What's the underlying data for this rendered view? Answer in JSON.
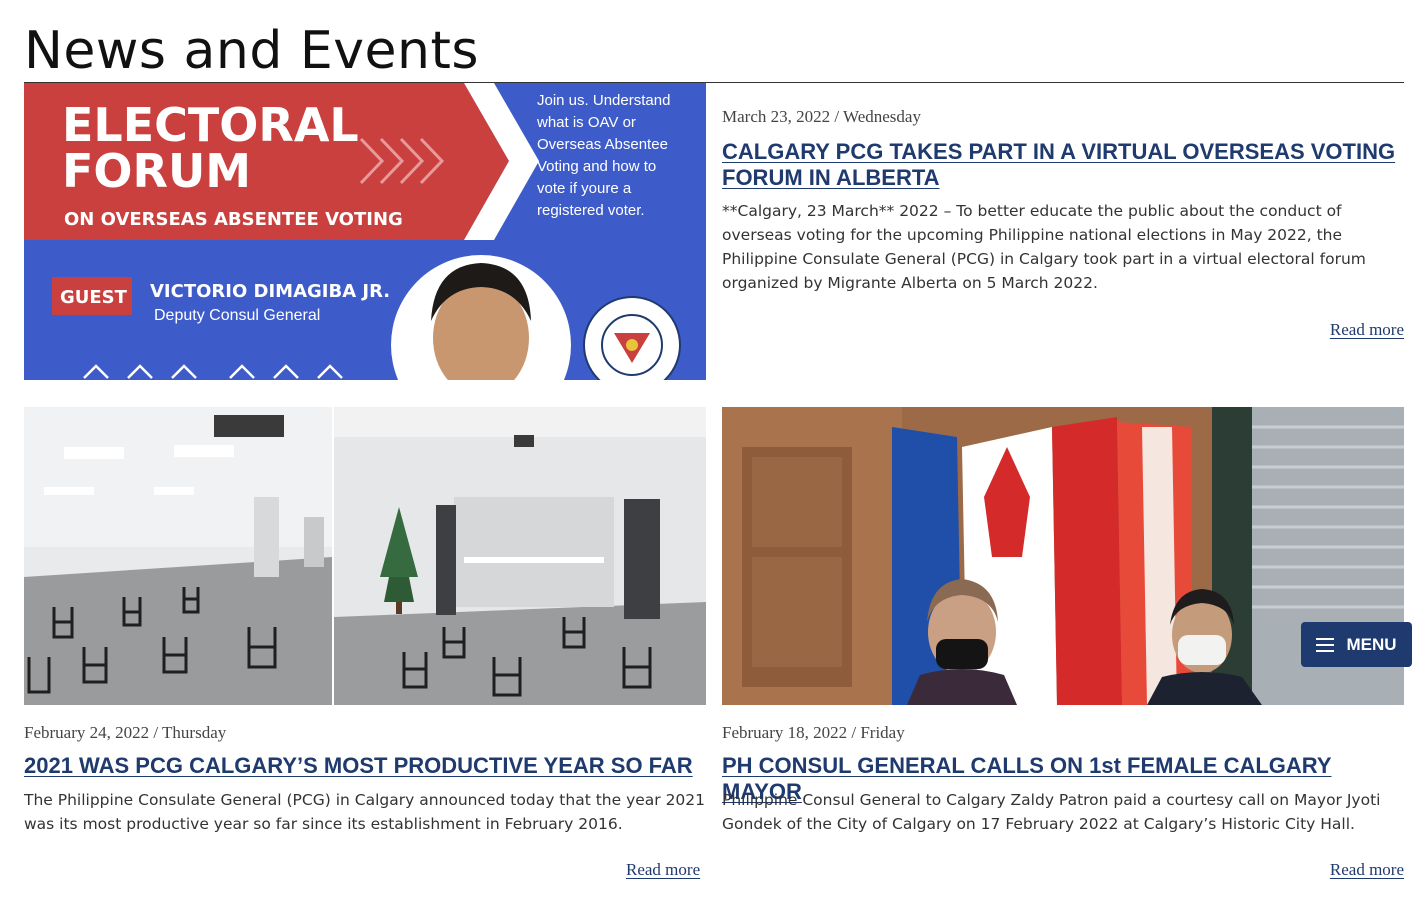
{
  "page": {
    "title": "News and Events"
  },
  "menu": {
    "label": "MENU"
  },
  "banner": {
    "title_line1": "ELECTORAL",
    "title_line2": "FORUM",
    "subtitle": "ON OVERSEAS ABSENTEE VOTING",
    "invite": [
      "Join us. Understand",
      "what is OAV or",
      "Overseas Absentee",
      "Voting and how to",
      "vote if youre  a",
      "registered voter."
    ],
    "guest_tag": "GUEST",
    "guest_name": "VICTORIO DIMAGIBA JR.",
    "guest_role": "Deputy Consul General",
    "seal_text": "PHILIPPINE CONSULATE GENERAL"
  },
  "articles": [
    {
      "date": "March 23, 2022 / Wednesday",
      "headline": "CALGARY PCG TAKES PART IN A VIRTUAL OVERSEAS VOTING FORUM IN ALBERTA",
      "excerpt": "**Calgary, 23 March** 2022 – To better educate the public about the conduct of overseas voting for the upcoming Philippine national elections in May 2022, the Philippine Consulate General (PCG) in Calgary took part in a virtual electoral forum organized by Migrante Alberta on 5 March 2022.",
      "read_more": "Read more"
    },
    {
      "date": "February 24, 2022 / Thursday",
      "headline": "2021 WAS PCG CALGARY’S MOST PRODUCTIVE YEAR SO FAR",
      "excerpt": "The Philippine Consulate General (PCG) in Calgary announced today that the year 2021 was its most productive year so far since its establishment in February 2016.",
      "read_more": "Read more"
    },
    {
      "date": "February 18, 2022 / Friday",
      "headline": "PH CONSUL GENERAL CALLS ON 1st FEMALE CALGARY MAYOR",
      "excerpt": "Philippine Consul General to Calgary Zaldy Patron paid a courtesy call on Mayor Jyoti Gondek of the City of Calgary on 17 February 2022 at Calgary’s Historic City Hall.",
      "read_more": "Read more"
    }
  ]
}
